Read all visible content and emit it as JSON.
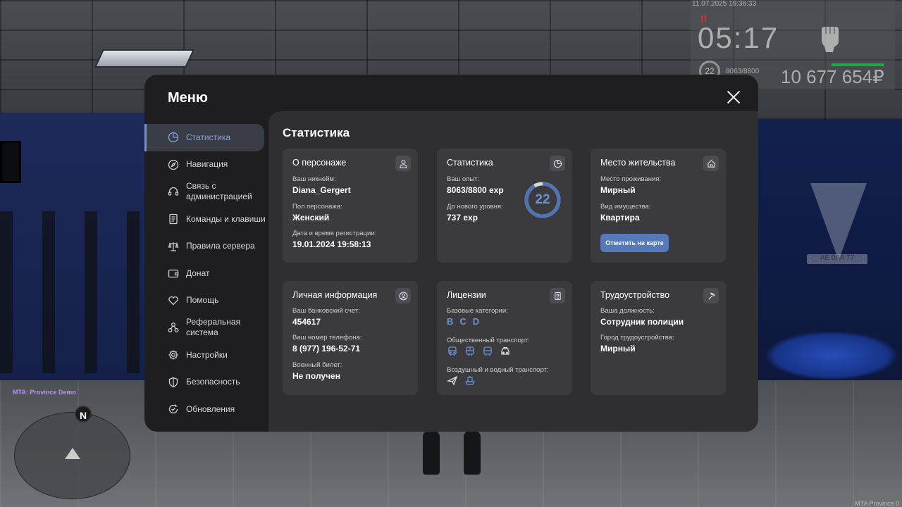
{
  "hud": {
    "datetime": "11.07.2025 19:36:33",
    "alert": "!!",
    "time": "05:17",
    "level": "22",
    "exp": "8063/8800",
    "money": "10 677 654₽"
  },
  "server_tag": "MTA: Province Demo",
  "watermark": "MTA Province 0",
  "radar": {
    "north": "N"
  },
  "plate": "AE 0AA 77",
  "menu": {
    "title": "Меню",
    "sidebar": [
      {
        "label": "Статистика",
        "icon": "pie-chart-icon",
        "active": true
      },
      {
        "label": "Навигация",
        "icon": "compass-icon"
      },
      {
        "label": "Связь с администрацией",
        "icon": "headset-icon"
      },
      {
        "label": "Команды и клавиши",
        "icon": "document-icon"
      },
      {
        "label": "Правила сервера",
        "icon": "scales-icon"
      },
      {
        "label": "Донат",
        "icon": "wallet-icon"
      },
      {
        "label": "Помощь",
        "icon": "heart-hand-icon"
      },
      {
        "label": "Реферальная система",
        "icon": "network-icon"
      },
      {
        "label": "Настройки",
        "icon": "gear-icon"
      },
      {
        "label": "Безопасность",
        "icon": "shield-icon"
      },
      {
        "label": "Обновления",
        "icon": "refresh-check-icon"
      }
    ],
    "content_title": "Статистика",
    "cards": {
      "character": {
        "title": "О персонаже",
        "icon": "user-icon",
        "nickname_label": "Ваш никнейм:",
        "nickname": "Diana_Gergert",
        "gender_label": "Пол персонажа:",
        "gender": "Женский",
        "reg_label": "Дата и время регистрации:",
        "reg": "19.01.2024 19:58:13"
      },
      "stats": {
        "title": "Статистика",
        "icon": "pie-chart-icon",
        "exp_label": "Ваш опыт:",
        "exp": "8063/8800 exp",
        "next_label": "До нового уровня:",
        "next": "737 exp",
        "level": "22",
        "progress": 0.916
      },
      "residence": {
        "title": "Место жительства",
        "icon": "home-icon",
        "place_label": "Место проживания:",
        "place": "Мирный",
        "property_label": "Вид имущества:",
        "property": "Квартира",
        "map_button": "Отметить на карте"
      },
      "personal": {
        "title": "Личная информация",
        "icon": "user-circle-icon",
        "bank_label": "Ваш банковский счет:",
        "bank": "454617",
        "phone_label": "Ваш номер телефона:",
        "phone": "8 (977) 196-52-71",
        "military_label": "Военный билет:",
        "military": "Не получен"
      },
      "licenses": {
        "title": "Лицензии",
        "icon": "id-card-icon",
        "base_label": "Базовые категории:",
        "categories": [
          "B",
          "C",
          "D"
        ],
        "public_label": "Общественный транспорт:",
        "public_icons": [
          "bus-icon",
          "bus-icon",
          "bus-icon",
          "taxi-icon"
        ],
        "air_label": "Воздушный и водный транспорт:",
        "air_icons": [
          "plane-icon",
          "boat-icon"
        ]
      },
      "job": {
        "title": "Трудоустройство",
        "icon": "pickaxe-icon",
        "position_label": "Ваша должность:",
        "position": "Сотрудник полиции",
        "city_label": "Город трудоустройства:",
        "city": "Мирный"
      }
    }
  },
  "colors": {
    "accent": "#6b93d6",
    "button": "#5679b9",
    "card": "#3b3b3e",
    "panel": "#2f2f31",
    "sidebar": "#1e1e20"
  }
}
